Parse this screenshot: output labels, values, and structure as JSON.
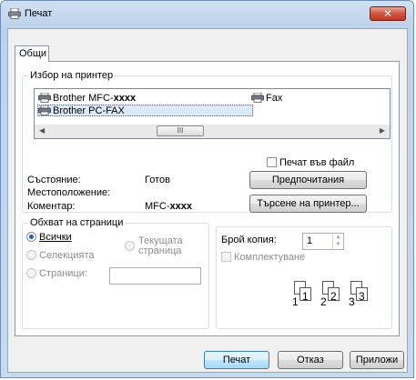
{
  "window": {
    "title": "Печат"
  },
  "tabs": [
    {
      "label": "Общи"
    }
  ],
  "printer_group": {
    "legend": "Избор на принтер",
    "printers": [
      {
        "name": "Brother MFC-",
        "suffix": "xxxx"
      },
      {
        "name": "Fax"
      },
      {
        "name": "Brother PC-FAX",
        "selected": true
      }
    ],
    "scroll_thumb": "III",
    "print_to_file": "Печат във файл",
    "status_label": "Състояние:",
    "status_value": "Готов",
    "location_label": "Местоположение:",
    "comment_label": "Коментар:",
    "comment_value": "MFC-",
    "comment_suffix": "xxxx",
    "preferences_button": "Предпочитания",
    "find_printer_button": "Търсене на принтер..."
  },
  "range_group": {
    "legend": "Обхват на страници",
    "all": "Всички",
    "selection": "Селекцията",
    "current_page_line1": "Текущата",
    "current_page_line2": "страница",
    "pages": "Страници:",
    "pages_value": ""
  },
  "copies_group": {
    "copies_label": "Брой копия:",
    "copies_value": "1",
    "collate": "Комплектуване",
    "collate_numbers": [
      "1",
      "1",
      "2",
      "2",
      "3",
      "3"
    ]
  },
  "footer": {
    "print_button": "Печат",
    "cancel_button": "Отказ",
    "apply_button": "Приложи"
  },
  "colors": {
    "close": "#c23a20",
    "accent": "#1a5fbf",
    "frame": "#bcd3ec"
  }
}
